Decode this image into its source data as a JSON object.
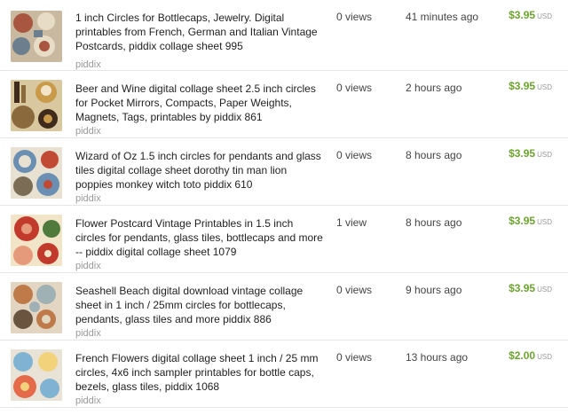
{
  "listings": [
    {
      "title": "1 inch Circles for Bottlecaps, Jewelry. Digital printables from French, German and Italian Vintage Postcards, piddix collage sheet 995",
      "shop": "piddix",
      "views": "0 views",
      "time": "41 minutes ago",
      "price": "$3.95",
      "currency": "USD"
    },
    {
      "title": "Beer and Wine digital collage sheet 2.5 inch circles for Pocket Mirrors, Compacts, Paper Weights, Magnets, Tags, printables by piddix 861",
      "shop": "piddix",
      "views": "0 views",
      "time": "2 hours ago",
      "price": "$3.95",
      "currency": "USD"
    },
    {
      "title": "Wizard of Oz 1.5 inch circles for pendants and glass tiles digital collage sheet dorothy tin man lion poppies monkey witch toto piddix 610",
      "shop": "piddix",
      "views": "0 views",
      "time": "8 hours ago",
      "price": "$3.95",
      "currency": "USD"
    },
    {
      "title": "Flower Postcard Vintage Printables in 1.5 inch circles for pendants, glass tiles, bottlecaps and more -- piddix digital collage sheet 1079",
      "shop": "piddix",
      "views": "1 view",
      "time": "8 hours ago",
      "price": "$3.95",
      "currency": "USD"
    },
    {
      "title": "Seashell Beach digital download vintage collage sheet in 1 inch / 25mm circles for bottlecaps, pendants, glass tiles and more piddix 886",
      "shop": "piddix",
      "views": "0 views",
      "time": "9 hours ago",
      "price": "$3.95",
      "currency": "USD"
    },
    {
      "title": "French Flowers digital collage sheet 1 inch / 25 mm circles, 4x6 inch sampler printables for bottle caps, bezels, glass tiles, piddix 1068",
      "shop": "piddix",
      "views": "0 views",
      "time": "13 hours ago",
      "price": "$2.00",
      "currency": "USD"
    }
  ],
  "thumb_palettes": [
    [
      "#c9b9a0",
      "#a8563f",
      "#e7dcc6",
      "#6b7f8e"
    ],
    [
      "#8a6a3c",
      "#c89a4a",
      "#3f2a1b",
      "#d9c7a0"
    ],
    [
      "#6b8fb3",
      "#e8e1d2",
      "#c04a34",
      "#7a6c55"
    ],
    [
      "#c23a2c",
      "#e59a7b",
      "#f1e4c9",
      "#4f7a3c"
    ],
    [
      "#e2d6c2",
      "#bf7a4a",
      "#6a5440",
      "#9fb1b5"
    ],
    [
      "#e46a4a",
      "#7fb3d1",
      "#f2d27a",
      "#e9e2d6"
    ]
  ]
}
